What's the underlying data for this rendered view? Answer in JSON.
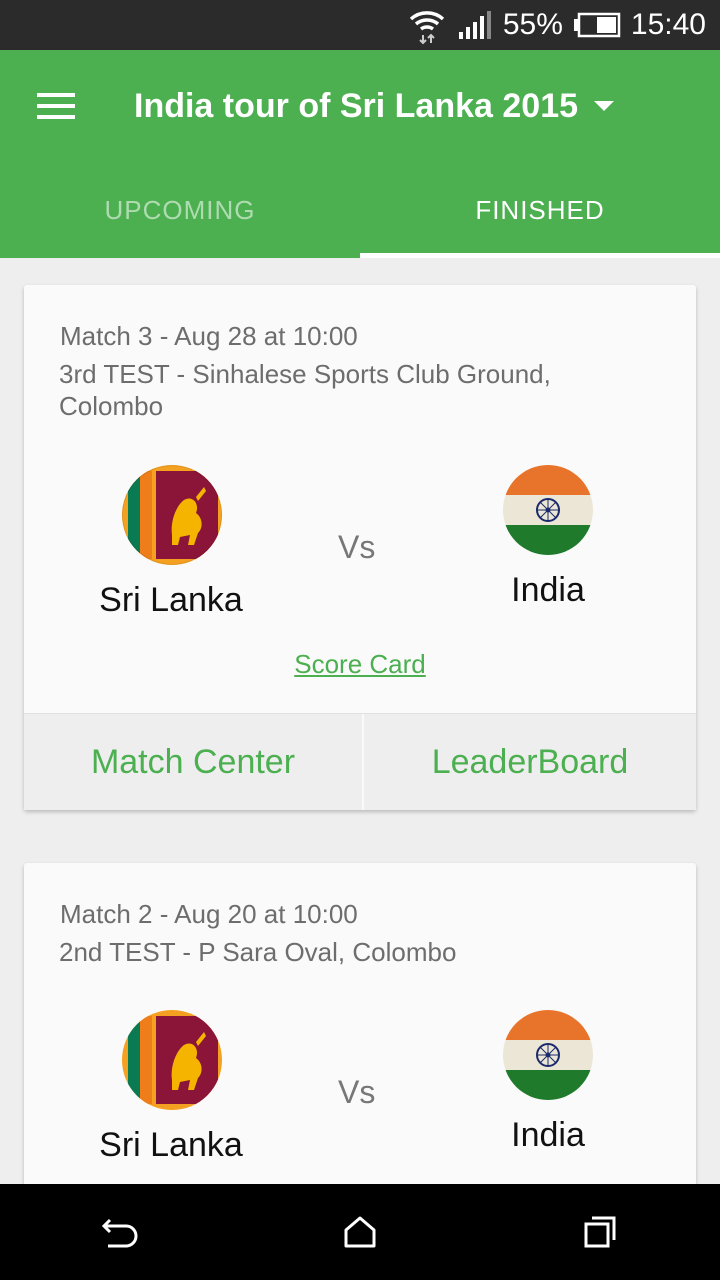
{
  "status_bar": {
    "battery": "55%",
    "time": "15:40",
    "wifi_icon": "wifi-icon",
    "signal_icon": "signal-icon",
    "battery_icon": "battery-icon"
  },
  "appbar": {
    "title": "India tour of Sri Lanka 2015",
    "menu_icon": "menu-icon",
    "dropdown_icon": "dropdown-arrow-icon"
  },
  "tabs": [
    {
      "label": "UPCOMING",
      "active": false
    },
    {
      "label": "FINISHED",
      "active": true
    }
  ],
  "matches": [
    {
      "header": "Match 3 - Aug 28 at 10:00",
      "venue": "3rd TEST - Sinhalese Sports Club Ground, Colombo",
      "team1": "Sri Lanka",
      "team2": "India",
      "vs": "Vs",
      "scorecard": "Score Card",
      "match_center": "Match Center",
      "leaderboard": "LeaderBoard"
    },
    {
      "header": "Match 2 - Aug 20 at 10:00",
      "venue": "2nd TEST - P Sara Oval, Colombo",
      "team1": "Sri Lanka",
      "team2": "India",
      "vs": "Vs"
    }
  ],
  "navbar": {
    "back_icon": "back-icon",
    "home_icon": "home-icon",
    "recents_icon": "recents-icon"
  },
  "colors": {
    "primary": "#4caf50",
    "status_bar": "#2b2b2b",
    "background": "#eeeeee"
  }
}
